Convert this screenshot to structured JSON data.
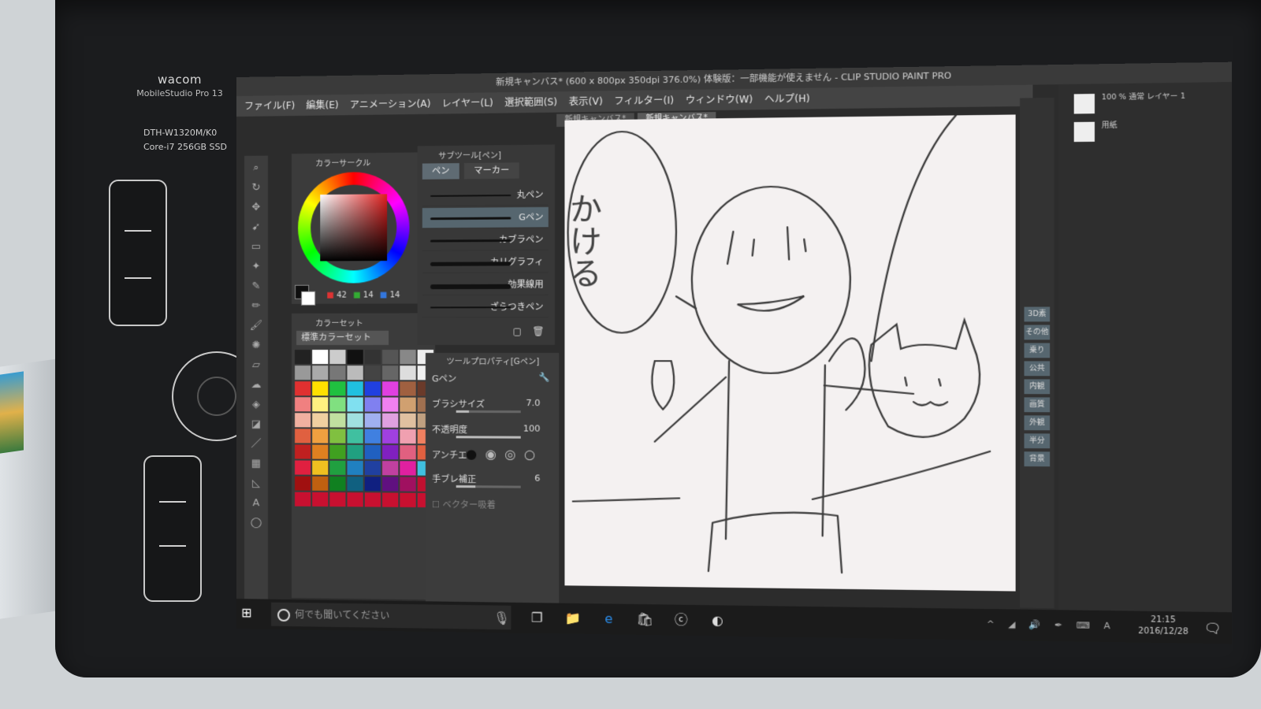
{
  "device": {
    "brand": "wacom",
    "model": "MobileStudio Pro 13",
    "model_number": "DTH-W1320M/K0",
    "spec": "Core-i7 256GB SSD"
  },
  "window": {
    "title": "新規キャンバス* (600 x 800px 350dpi 376.0%) 体験版：一部機能が使えません - CLIP STUDIO PAINT PRO"
  },
  "menu": [
    "ファイル(F)",
    "編集(E)",
    "アニメーション(A)",
    "レイヤー(L)",
    "選択範囲(S)",
    "表示(V)",
    "フィルター(I)",
    "ウィンドウ(W)",
    "ヘルプ(H)"
  ],
  "doc_tabs": [
    "新規キャンバス*",
    "新規キャンバス*"
  ],
  "color_panel": {
    "tab": "カラーサークル",
    "r": "42",
    "g": "14",
    "b": "14"
  },
  "color_set": {
    "tab": "カラーセット",
    "selected_set": "標準カラーセット",
    "swatches": [
      "#222",
      "#fff",
      "#ccc",
      "#111",
      "#333",
      "#555",
      "#888",
      "#eee",
      "#999",
      "#aaa",
      "#777",
      "#bbb",
      "#444",
      "#666",
      "#ddd",
      "#f0f0f0",
      "#e03030",
      "#ffe000",
      "#20c040",
      "#20c0e0",
      "#2040e0",
      "#e040e0",
      "#a06040",
      "#6a3a2a",
      "#f08080",
      "#fff080",
      "#80e080",
      "#80e0f0",
      "#8080f0",
      "#f080f0",
      "#d0a070",
      "#a07050",
      "#f0b0a0",
      "#f0d0a0",
      "#c0e0a0",
      "#a0e0e0",
      "#a0b0f0",
      "#e0a0e0",
      "#e0c0a0",
      "#c0a080",
      "#e06040",
      "#f0a040",
      "#80c040",
      "#40c0a0",
      "#4080e0",
      "#a040e0",
      "#f0a0b0",
      "#f08060",
      "#c02020",
      "#e08020",
      "#40a020",
      "#20a080",
      "#2060c0",
      "#8020c0",
      "#e06080",
      "#e06040",
      "#e02040",
      "#f0c020",
      "#20a040",
      "#2080c0",
      "#2040a0",
      "#c040a0",
      "#e020a0",
      "#40c0e0",
      "#a01010",
      "#c06010",
      "#108020",
      "#106080",
      "#102080",
      "#601080",
      "#a01060",
      "#c01030",
      "#c81030",
      "#c81030",
      "#c81030",
      "#c81030",
      "#c81030",
      "#c81030",
      "#c81030",
      "#c81030"
    ]
  },
  "sub_tool": {
    "tab": "サブツール[ペン]",
    "tabs": [
      "ペン",
      "マーカー"
    ],
    "brushes": [
      "丸ペン",
      "Gペン",
      "カブラペン",
      "カリグラフィ",
      "効果線用",
      "ざらつきペン"
    ],
    "selected": "Gペン"
  },
  "tool_property": {
    "tab": "ツールプロパティ[Gペン]",
    "tool_name": "Gペン",
    "brush_size_label": "ブラシサイズ",
    "brush_size": "7.0",
    "brush_size_fraction": 0.2,
    "opacity_label": "不透明度",
    "opacity": "100",
    "opacity_fraction": 1.0,
    "antialias_label": "アンチエ",
    "stabilization_label": "手ブレ補正",
    "stabilization": "6",
    "stabilization_fraction": 0.3,
    "vector_snap_label": "ベクター吸着"
  },
  "layer_tags": [
    "3D素",
    "その他",
    "乗り",
    "公共",
    "内観",
    "画質",
    "外観",
    "半分",
    "背景"
  ],
  "layers": [
    {
      "name": "100 % 通常 レイヤー 1"
    },
    {
      "name": "用紙"
    }
  ],
  "canvas_text": "かける",
  "taskbar": {
    "search_placeholder": "何でも聞いてください",
    "time": "21:15",
    "date": "2016/12/28",
    "ime": "A"
  }
}
